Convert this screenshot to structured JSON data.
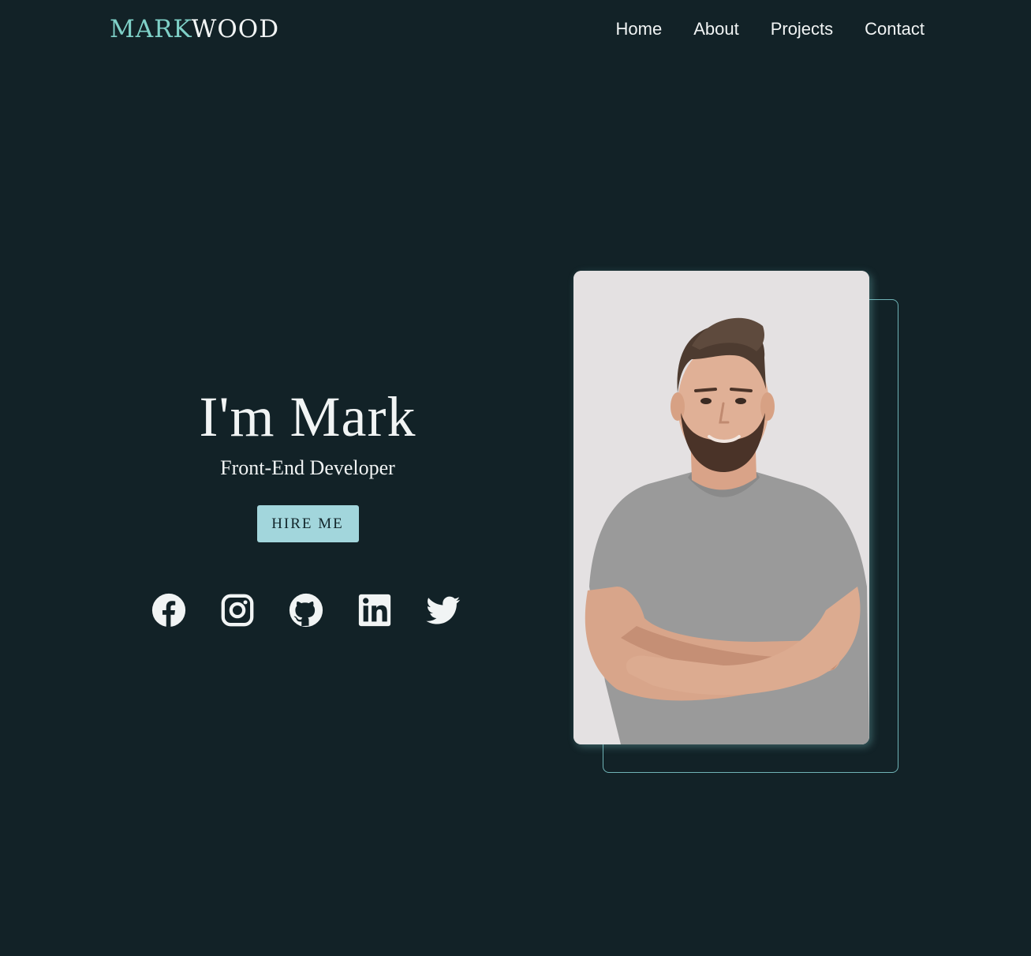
{
  "header": {
    "logo_first": "MARK",
    "logo_second": "WOOD",
    "nav": [
      "Home",
      "About",
      "Projects",
      "Contact"
    ]
  },
  "hero": {
    "title": "I'm Mark",
    "subtitle": "Front-End Developer",
    "cta_label": "HIRE ME"
  },
  "socials": [
    "facebook-icon",
    "instagram-icon",
    "github-icon",
    "linkedin-icon",
    "twitter-icon"
  ],
  "colors": {
    "background": "#122227",
    "accent": "#7fd1c8",
    "button": "#a2d6dc",
    "text": "#f1f4f4",
    "photo_bg": "#e4e1e2"
  }
}
